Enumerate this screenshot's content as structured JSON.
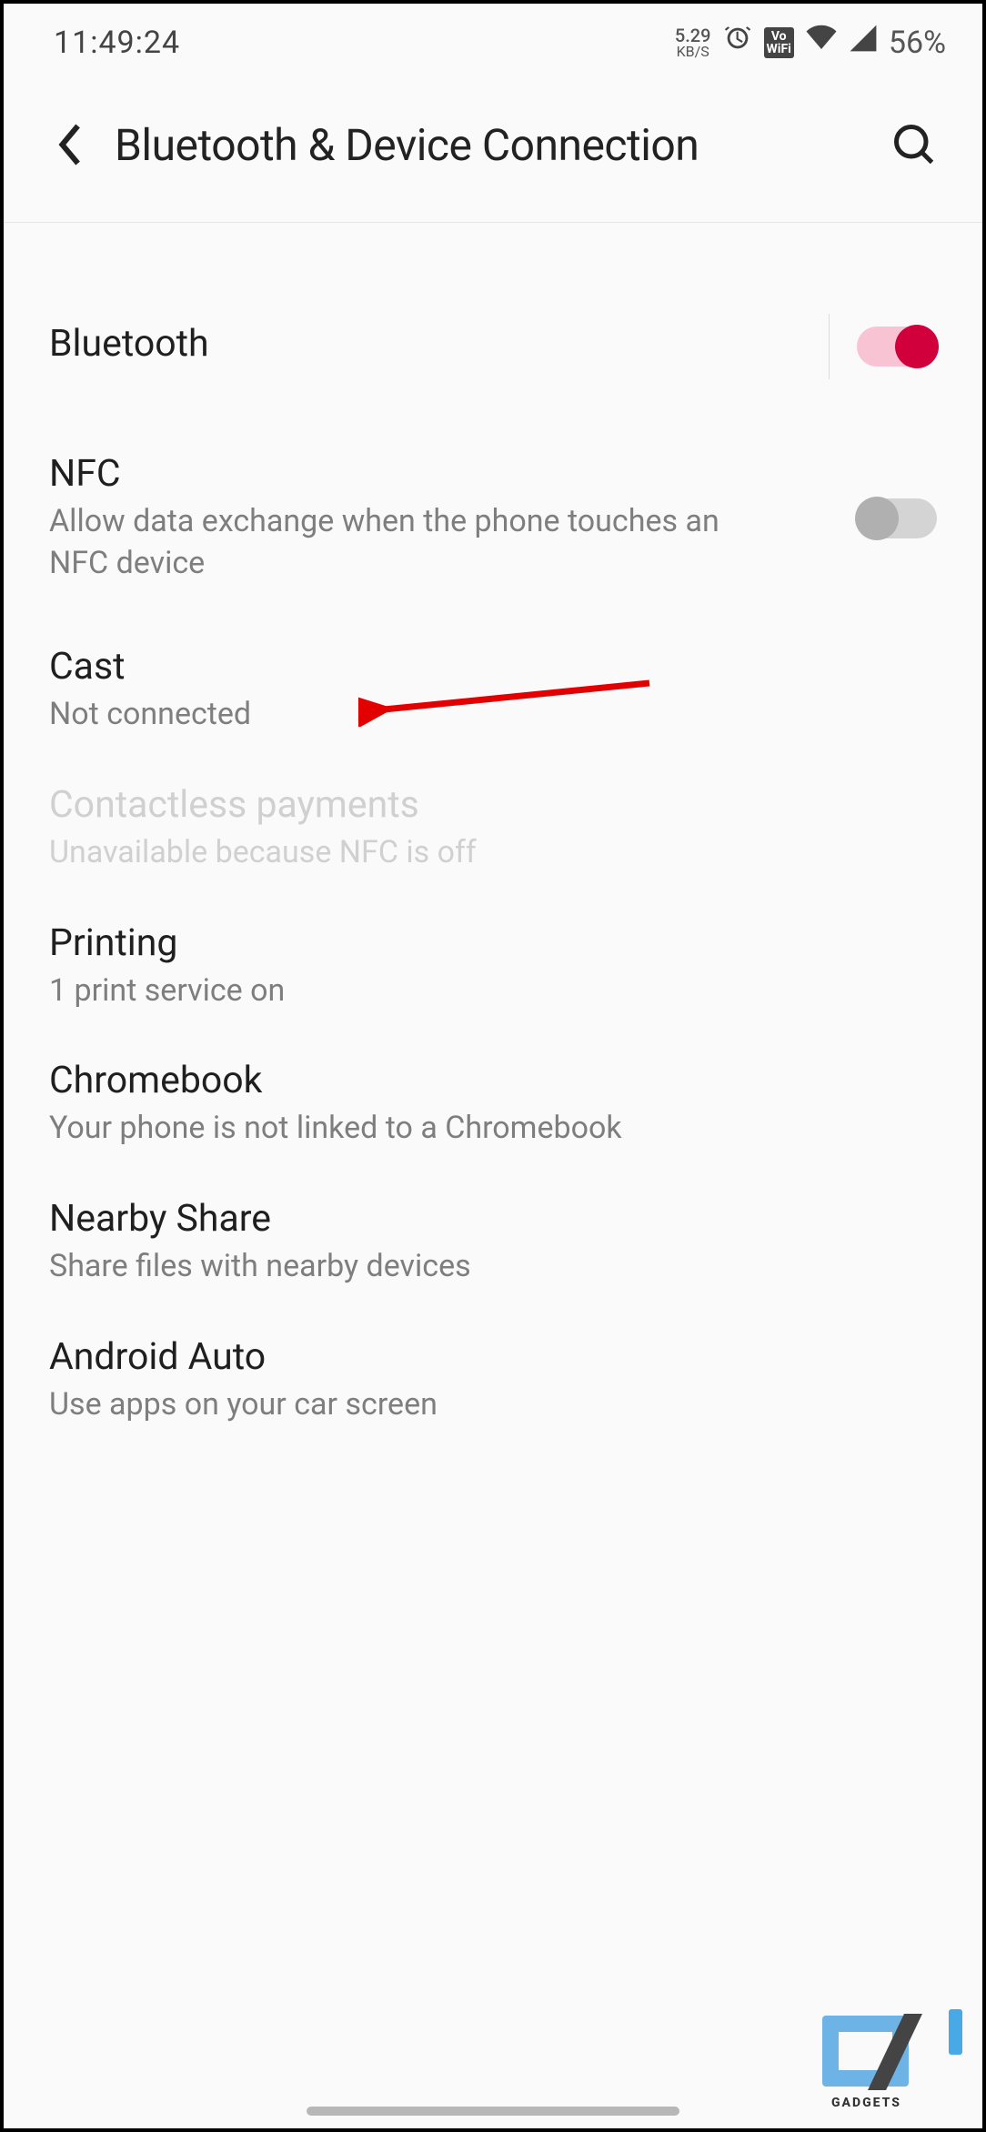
{
  "status": {
    "time": "11:49:24",
    "speed_value": "5.29",
    "speed_unit": "KB/S",
    "vowifi": "Vo\nWiFi",
    "battery": "56%"
  },
  "header": {
    "title": "Bluetooth & Device Connection"
  },
  "rows": [
    {
      "title": "Bluetooth",
      "sub": "",
      "toggle": "on"
    },
    {
      "title": "NFC",
      "sub": "Allow data exchange when the phone touches an NFC device",
      "toggle": "off"
    },
    {
      "title": "Cast",
      "sub": "Not connected"
    },
    {
      "title": "Contactless payments",
      "sub": "Unavailable because NFC is off",
      "disabled": true
    },
    {
      "title": "Printing",
      "sub": "1 print service on"
    },
    {
      "title": "Chromebook",
      "sub": "Your phone is not linked to a Chromebook"
    },
    {
      "title": "Nearby Share",
      "sub": "Share files with nearby devices"
    },
    {
      "title": "Android Auto",
      "sub": "Use apps on your car screen"
    }
  ],
  "watermark": "GADGETS"
}
